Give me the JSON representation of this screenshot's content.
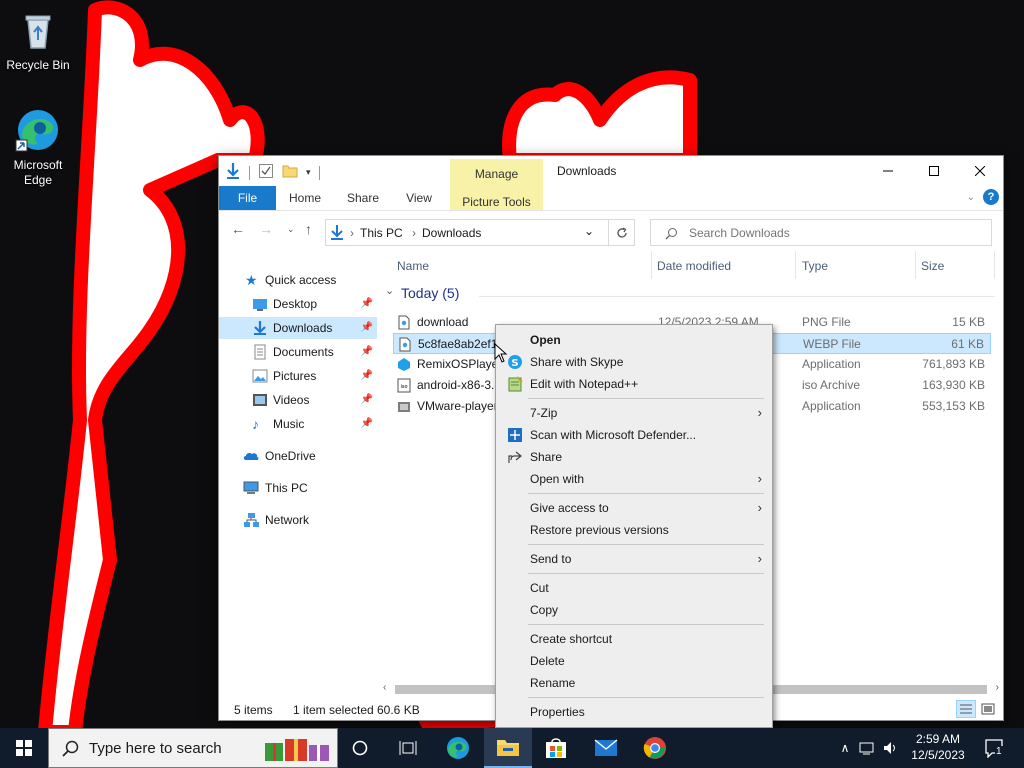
{
  "desktop": {
    "icons": [
      {
        "label": "Recycle Bin",
        "icon": "recycle-bin-icon"
      },
      {
        "label": "Microsoft Edge",
        "icon": "edge-icon"
      }
    ]
  },
  "explorer": {
    "title": "Downloads",
    "manage_label": "Manage",
    "picture_tools_label": "Picture Tools",
    "ribbon_tabs": [
      "File",
      "Home",
      "Share",
      "View"
    ],
    "address": {
      "crumbs": [
        "This PC",
        "Downloads"
      ]
    },
    "search": {
      "placeholder": "Search Downloads"
    },
    "nav": {
      "quick_access": "Quick access",
      "items": [
        "Desktop",
        "Downloads",
        "Documents",
        "Pictures",
        "Videos",
        "Music"
      ],
      "onedrive": "OneDrive",
      "this_pc": "This PC",
      "network": "Network"
    },
    "columns": {
      "name": "Name",
      "date": "Date modified",
      "type": "Type",
      "size": "Size"
    },
    "group_label": "Today (5)",
    "files": [
      {
        "name": "download",
        "date": "12/5/2023 2:59 AM",
        "type": "PNG File",
        "size": "15 KB"
      },
      {
        "name": "5c8fae8ab2ef12",
        "date": "",
        "type": "WEBP File",
        "size": "61 KB"
      },
      {
        "name": "RemixOSPlayer",
        "date": "",
        "type": "Application",
        "size": "761,893 KB"
      },
      {
        "name": "android-x86-3.",
        "date": "",
        "type": "iso Archive",
        "size": "163,930 KB"
      },
      {
        "name": "VMware-player",
        "date": "",
        "type": "Application",
        "size": "553,153 KB"
      }
    ],
    "status": {
      "items": "5 items",
      "selected": "1 item selected",
      "size": "60.6 KB"
    }
  },
  "context_menu": {
    "items": {
      "open": "Open",
      "share_skype": "Share with Skype",
      "edit_npp": "Edit with Notepad++",
      "zip": "7-Zip",
      "defender": "Scan with Microsoft Defender...",
      "share": "Share",
      "open_with": "Open with",
      "give_access": "Give access to",
      "restore": "Restore previous versions",
      "send_to": "Send to",
      "cut": "Cut",
      "copy": "Copy",
      "create_shortcut": "Create shortcut",
      "delete": "Delete",
      "rename": "Rename",
      "properties": "Properties"
    }
  },
  "taskbar": {
    "search_placeholder": "Type here to search",
    "time": "2:59 AM",
    "date": "12/5/2023",
    "notification_count": "1"
  },
  "colors": {
    "accent": "#1979ca",
    "selection": "#cce8ff",
    "manage_tab": "#f7f2a8",
    "wallpaper_red": "#ff0000"
  }
}
